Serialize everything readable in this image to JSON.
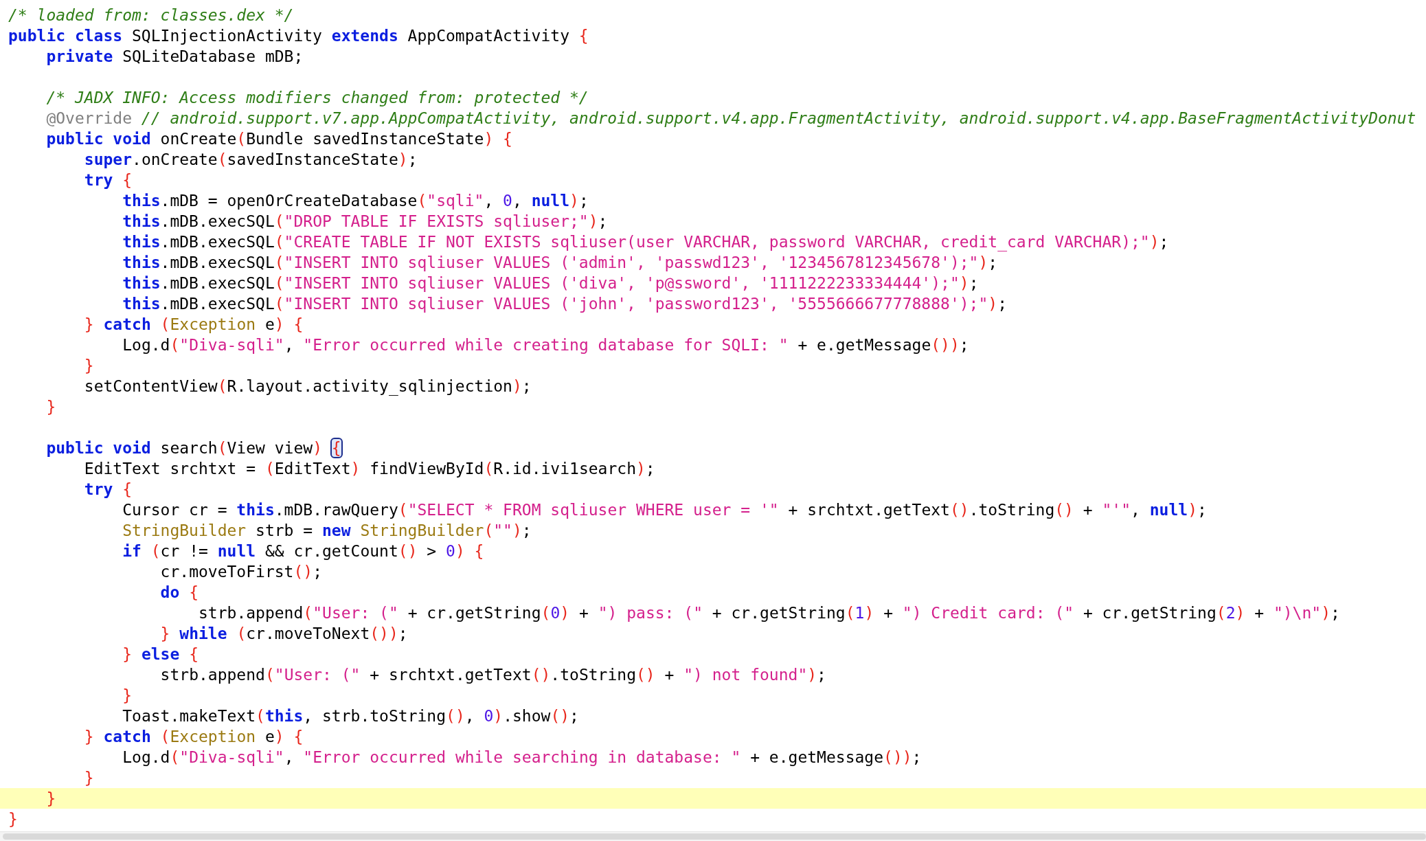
{
  "editor": {
    "lines": [
      {
        "kind": "code",
        "current": false,
        "tokens": [
          {
            "kind": "comment",
            "text": "/* loaded from: classes.dex */"
          }
        ]
      },
      {
        "kind": "code",
        "current": false,
        "tokens": [
          {
            "kind": "keyword",
            "text": "public class"
          },
          {
            "kind": "plain",
            "text": " SQLInjectionActivity "
          },
          {
            "kind": "keyword",
            "text": "extends"
          },
          {
            "kind": "plain",
            "text": " AppCompatActivity "
          },
          {
            "kind": "bracket",
            "text": "{"
          }
        ],
        "children": [
          {
            "kind": "code",
            "current": false,
            "tokens": [
              {
                "kind": "keyword",
                "text": "private"
              },
              {
                "kind": "plain",
                "text": " SQLiteDatabase mDB;"
              }
            ]
          },
          {
            "kind": "blank"
          },
          {
            "kind": "code",
            "current": false,
            "tokens": [
              {
                "kind": "comment",
                "text": "/* JADX INFO: Access modifiers changed from: protected */"
              }
            ]
          },
          {
            "kind": "code",
            "current": false,
            "tokens": [
              {
                "kind": "annotation",
                "text": "@Override"
              },
              {
                "kind": "comment",
                "text": " // android.support.v7.app.AppCompatActivity, android.support.v4.app.FragmentActivity, android.support.v4.app.BaseFragmentActivityDonut"
              }
            ]
          },
          {
            "kind": "code",
            "current": false,
            "tokens": [
              {
                "kind": "keyword",
                "text": "public void"
              },
              {
                "kind": "plain",
                "text": " onCreate"
              },
              {
                "kind": "bracket",
                "text": "("
              },
              {
                "kind": "plain",
                "text": "Bundle savedInstanceState"
              },
              {
                "kind": "bracket",
                "text": ") {"
              }
            ],
            "children": [
              {
                "kind": "code",
                "current": false,
                "tokens": [
                  {
                    "kind": "keyword",
                    "text": "super"
                  },
                  {
                    "kind": "plain",
                    "text": ".onCreate"
                  },
                  {
                    "kind": "bracket",
                    "text": "("
                  },
                  {
                    "kind": "plain",
                    "text": "savedInstanceState"
                  },
                  {
                    "kind": "bracket",
                    "text": ")"
                  },
                  {
                    "kind": "plain",
                    "text": ";"
                  }
                ]
              },
              {
                "kind": "code",
                "current": false,
                "tokens": [
                  {
                    "kind": "keyword",
                    "text": "try"
                  },
                  {
                    "kind": "bracket",
                    "text": " {"
                  }
                ],
                "children": [
                  {
                    "kind": "code",
                    "current": false,
                    "tokens": [
                      {
                        "kind": "keyword",
                        "text": "this"
                      },
                      {
                        "kind": "plain",
                        "text": ".mDB = openOrCreateDatabase"
                      },
                      {
                        "kind": "bracket",
                        "text": "("
                      },
                      {
                        "kind": "string",
                        "text": "\"sqli\""
                      },
                      {
                        "kind": "plain",
                        "text": ", "
                      },
                      {
                        "kind": "number",
                        "text": "0"
                      },
                      {
                        "kind": "plain",
                        "text": ", "
                      },
                      {
                        "kind": "keyword",
                        "text": "null"
                      },
                      {
                        "kind": "bracket",
                        "text": ")"
                      },
                      {
                        "kind": "plain",
                        "text": ";"
                      }
                    ]
                  },
                  {
                    "kind": "code",
                    "current": false,
                    "tokens": [
                      {
                        "kind": "keyword",
                        "text": "this"
                      },
                      {
                        "kind": "plain",
                        "text": ".mDB.execSQL"
                      },
                      {
                        "kind": "bracket",
                        "text": "("
                      },
                      {
                        "kind": "string",
                        "text": "\"DROP TABLE IF EXISTS sqliuser;\""
                      },
                      {
                        "kind": "bracket",
                        "text": ")"
                      },
                      {
                        "kind": "plain",
                        "text": ";"
                      }
                    ]
                  },
                  {
                    "kind": "code",
                    "current": false,
                    "tokens": [
                      {
                        "kind": "keyword",
                        "text": "this"
                      },
                      {
                        "kind": "plain",
                        "text": ".mDB.execSQL"
                      },
                      {
                        "kind": "bracket",
                        "text": "("
                      },
                      {
                        "kind": "string",
                        "text": "\"CREATE TABLE IF NOT EXISTS sqliuser(user VARCHAR, password VARCHAR, credit_card VARCHAR);\""
                      },
                      {
                        "kind": "bracket",
                        "text": ")"
                      },
                      {
                        "kind": "plain",
                        "text": ";"
                      }
                    ]
                  },
                  {
                    "kind": "code",
                    "current": false,
                    "tokens": [
                      {
                        "kind": "keyword",
                        "text": "this"
                      },
                      {
                        "kind": "plain",
                        "text": ".mDB.execSQL"
                      },
                      {
                        "kind": "bracket",
                        "text": "("
                      },
                      {
                        "kind": "string",
                        "text": "\"INSERT INTO sqliuser VALUES ('admin', 'passwd123', '1234567812345678');\""
                      },
                      {
                        "kind": "bracket",
                        "text": ")"
                      },
                      {
                        "kind": "plain",
                        "text": ";"
                      }
                    ]
                  },
                  {
                    "kind": "code",
                    "current": false,
                    "tokens": [
                      {
                        "kind": "keyword",
                        "text": "this"
                      },
                      {
                        "kind": "plain",
                        "text": ".mDB.execSQL"
                      },
                      {
                        "kind": "bracket",
                        "text": "("
                      },
                      {
                        "kind": "string",
                        "text": "\"INSERT INTO sqliuser VALUES ('diva', 'p@ssword', '1111222233334444');\""
                      },
                      {
                        "kind": "bracket",
                        "text": ")"
                      },
                      {
                        "kind": "plain",
                        "text": ";"
                      }
                    ]
                  },
                  {
                    "kind": "code",
                    "current": false,
                    "tokens": [
                      {
                        "kind": "keyword",
                        "text": "this"
                      },
                      {
                        "kind": "plain",
                        "text": ".mDB.execSQL"
                      },
                      {
                        "kind": "bracket",
                        "text": "("
                      },
                      {
                        "kind": "string",
                        "text": "\"INSERT INTO sqliuser VALUES ('john', 'password123', '5555666677778888');\""
                      },
                      {
                        "kind": "bracket",
                        "text": ")"
                      },
                      {
                        "kind": "plain",
                        "text": ";"
                      }
                    ]
                  }
                ]
              },
              {
                "kind": "code",
                "current": false,
                "tokens": [
                  {
                    "kind": "bracket",
                    "text": "} "
                  },
                  {
                    "kind": "keyword",
                    "text": "catch"
                  },
                  {
                    "kind": "bracket",
                    "text": " ("
                  },
                  {
                    "kind": "type",
                    "text": "Exception"
                  },
                  {
                    "kind": "plain",
                    "text": " e"
                  },
                  {
                    "kind": "bracket",
                    "text": ") {"
                  }
                ],
                "children": [
                  {
                    "kind": "code",
                    "current": false,
                    "tokens": [
                      {
                        "kind": "plain",
                        "text": "Log.d"
                      },
                      {
                        "kind": "bracket",
                        "text": "("
                      },
                      {
                        "kind": "string",
                        "text": "\"Diva-sqli\""
                      },
                      {
                        "kind": "plain",
                        "text": ", "
                      },
                      {
                        "kind": "string",
                        "text": "\"Error occurred while creating database for SQLI: \""
                      },
                      {
                        "kind": "plain",
                        "text": " + e.getMessage"
                      },
                      {
                        "kind": "bracket",
                        "text": "())"
                      },
                      {
                        "kind": "plain",
                        "text": ";"
                      }
                    ]
                  }
                ]
              },
              {
                "kind": "code",
                "current": false,
                "tokens": [
                  {
                    "kind": "bracket",
                    "text": "}"
                  }
                ]
              },
              {
                "kind": "code",
                "current": false,
                "tokens": [
                  {
                    "kind": "plain",
                    "text": "setContentView"
                  },
                  {
                    "kind": "bracket",
                    "text": "("
                  },
                  {
                    "kind": "plain",
                    "text": "R.layout.activity_sqlinjection"
                  },
                  {
                    "kind": "bracket",
                    "text": ")"
                  },
                  {
                    "kind": "plain",
                    "text": ";"
                  }
                ]
              }
            ]
          },
          {
            "kind": "code",
            "current": false,
            "tokens": [
              {
                "kind": "bracket",
                "text": "}"
              }
            ]
          },
          {
            "kind": "blank"
          },
          {
            "kind": "code",
            "current": false,
            "tokens": [
              {
                "kind": "keyword",
                "text": "public void"
              },
              {
                "kind": "plain",
                "text": " search"
              },
              {
                "kind": "bracket",
                "text": "("
              },
              {
                "kind": "plain",
                "text": "View view"
              },
              {
                "kind": "bracket",
                "text": ") "
              },
              {
                "kind": "bracket",
                "text": "{",
                "matched": true
              }
            ],
            "children": [
              {
                "kind": "code",
                "current": false,
                "tokens": [
                  {
                    "kind": "plain",
                    "text": "EditText srchtxt = "
                  },
                  {
                    "kind": "bracket",
                    "text": "("
                  },
                  {
                    "kind": "plain",
                    "text": "EditText"
                  },
                  {
                    "kind": "bracket",
                    "text": ")"
                  },
                  {
                    "kind": "plain",
                    "text": " findViewById"
                  },
                  {
                    "kind": "bracket",
                    "text": "("
                  },
                  {
                    "kind": "plain",
                    "text": "R.id.ivi1search"
                  },
                  {
                    "kind": "bracket",
                    "text": ")"
                  },
                  {
                    "kind": "plain",
                    "text": ";"
                  }
                ]
              },
              {
                "kind": "code",
                "current": false,
                "tokens": [
                  {
                    "kind": "keyword",
                    "text": "try"
                  },
                  {
                    "kind": "bracket",
                    "text": " {"
                  }
                ],
                "children": [
                  {
                    "kind": "code",
                    "current": false,
                    "tokens": [
                      {
                        "kind": "plain",
                        "text": "Cursor cr = "
                      },
                      {
                        "kind": "keyword",
                        "text": "this"
                      },
                      {
                        "kind": "plain",
                        "text": ".mDB.rawQuery"
                      },
                      {
                        "kind": "bracket",
                        "text": "("
                      },
                      {
                        "kind": "string",
                        "text": "\"SELECT * FROM sqliuser WHERE user = '\""
                      },
                      {
                        "kind": "plain",
                        "text": " + srchtxt.getText"
                      },
                      {
                        "kind": "bracket",
                        "text": "()"
                      },
                      {
                        "kind": "plain",
                        "text": ".toString"
                      },
                      {
                        "kind": "bracket",
                        "text": "()"
                      },
                      {
                        "kind": "plain",
                        "text": " + "
                      },
                      {
                        "kind": "string",
                        "text": "\"'\""
                      },
                      {
                        "kind": "plain",
                        "text": ", "
                      },
                      {
                        "kind": "keyword",
                        "text": "null"
                      },
                      {
                        "kind": "bracket",
                        "text": ")"
                      },
                      {
                        "kind": "plain",
                        "text": ";"
                      }
                    ]
                  },
                  {
                    "kind": "code",
                    "current": false,
                    "tokens": [
                      {
                        "kind": "type",
                        "text": "StringBuilder"
                      },
                      {
                        "kind": "plain",
                        "text": " strb = "
                      },
                      {
                        "kind": "keyword",
                        "text": "new"
                      },
                      {
                        "kind": "type",
                        "text": " StringBuilder"
                      },
                      {
                        "kind": "bracket",
                        "text": "("
                      },
                      {
                        "kind": "string",
                        "text": "\"\""
                      },
                      {
                        "kind": "bracket",
                        "text": ")"
                      },
                      {
                        "kind": "plain",
                        "text": ";"
                      }
                    ]
                  },
                  {
                    "kind": "code",
                    "current": false,
                    "tokens": [
                      {
                        "kind": "keyword",
                        "text": "if"
                      },
                      {
                        "kind": "bracket",
                        "text": " ("
                      },
                      {
                        "kind": "plain",
                        "text": "cr != "
                      },
                      {
                        "kind": "keyword",
                        "text": "null"
                      },
                      {
                        "kind": "plain",
                        "text": " && cr.getCount"
                      },
                      {
                        "kind": "bracket",
                        "text": "()"
                      },
                      {
                        "kind": "plain",
                        "text": " > "
                      },
                      {
                        "kind": "number",
                        "text": "0"
                      },
                      {
                        "kind": "bracket",
                        "text": ") {"
                      }
                    ],
                    "children": [
                      {
                        "kind": "code",
                        "current": false,
                        "tokens": [
                          {
                            "kind": "plain",
                            "text": "cr.moveToFirst"
                          },
                          {
                            "kind": "bracket",
                            "text": "()"
                          },
                          {
                            "kind": "plain",
                            "text": ";"
                          }
                        ]
                      },
                      {
                        "kind": "code",
                        "current": false,
                        "tokens": [
                          {
                            "kind": "keyword",
                            "text": "do"
                          },
                          {
                            "kind": "bracket",
                            "text": " {"
                          }
                        ],
                        "children": [
                          {
                            "kind": "code",
                            "current": false,
                            "tokens": [
                              {
                                "kind": "plain",
                                "text": "strb.append"
                              },
                              {
                                "kind": "bracket",
                                "text": "("
                              },
                              {
                                "kind": "string",
                                "text": "\"User: (\""
                              },
                              {
                                "kind": "plain",
                                "text": " + cr.getString"
                              },
                              {
                                "kind": "bracket",
                                "text": "("
                              },
                              {
                                "kind": "number",
                                "text": "0"
                              },
                              {
                                "kind": "bracket",
                                "text": ")"
                              },
                              {
                                "kind": "plain",
                                "text": " + "
                              },
                              {
                                "kind": "string",
                                "text": "\") pass: (\""
                              },
                              {
                                "kind": "plain",
                                "text": " + cr.getString"
                              },
                              {
                                "kind": "bracket",
                                "text": "("
                              },
                              {
                                "kind": "number",
                                "text": "1"
                              },
                              {
                                "kind": "bracket",
                                "text": ")"
                              },
                              {
                                "kind": "plain",
                                "text": " + "
                              },
                              {
                                "kind": "string",
                                "text": "\") Credit card: (\""
                              },
                              {
                                "kind": "plain",
                                "text": " + cr.getString"
                              },
                              {
                                "kind": "bracket",
                                "text": "("
                              },
                              {
                                "kind": "number",
                                "text": "2"
                              },
                              {
                                "kind": "bracket",
                                "text": ")"
                              },
                              {
                                "kind": "plain",
                                "text": " + "
                              },
                              {
                                "kind": "string",
                                "text": "\")\\n\""
                              },
                              {
                                "kind": "bracket",
                                "text": ")"
                              },
                              {
                                "kind": "plain",
                                "text": ";"
                              }
                            ]
                          }
                        ]
                      },
                      {
                        "kind": "code",
                        "current": false,
                        "tokens": [
                          {
                            "kind": "bracket",
                            "text": "} "
                          },
                          {
                            "kind": "keyword",
                            "text": "while"
                          },
                          {
                            "kind": "bracket",
                            "text": " ("
                          },
                          {
                            "kind": "plain",
                            "text": "cr.moveToNext"
                          },
                          {
                            "kind": "bracket",
                            "text": "())"
                          },
                          {
                            "kind": "plain",
                            "text": ";"
                          }
                        ]
                      }
                    ]
                  },
                  {
                    "kind": "code",
                    "current": false,
                    "tokens": [
                      {
                        "kind": "bracket",
                        "text": "} "
                      },
                      {
                        "kind": "keyword",
                        "text": "else"
                      },
                      {
                        "kind": "bracket",
                        "text": " {"
                      }
                    ],
                    "children": [
                      {
                        "kind": "code",
                        "current": false,
                        "tokens": [
                          {
                            "kind": "plain",
                            "text": "strb.append"
                          },
                          {
                            "kind": "bracket",
                            "text": "("
                          },
                          {
                            "kind": "string",
                            "text": "\"User: (\""
                          },
                          {
                            "kind": "plain",
                            "text": " + srchtxt.getText"
                          },
                          {
                            "kind": "bracket",
                            "text": "()"
                          },
                          {
                            "kind": "plain",
                            "text": ".toString"
                          },
                          {
                            "kind": "bracket",
                            "text": "()"
                          },
                          {
                            "kind": "plain",
                            "text": " + "
                          },
                          {
                            "kind": "string",
                            "text": "\") not found\""
                          },
                          {
                            "kind": "bracket",
                            "text": ")"
                          },
                          {
                            "kind": "plain",
                            "text": ";"
                          }
                        ]
                      }
                    ]
                  },
                  {
                    "kind": "code",
                    "current": false,
                    "tokens": [
                      {
                        "kind": "bracket",
                        "text": "}"
                      }
                    ]
                  },
                  {
                    "kind": "code",
                    "current": false,
                    "tokens": [
                      {
                        "kind": "plain",
                        "text": "Toast.makeText"
                      },
                      {
                        "kind": "bracket",
                        "text": "("
                      },
                      {
                        "kind": "keyword",
                        "text": "this"
                      },
                      {
                        "kind": "plain",
                        "text": ", strb.toString"
                      },
                      {
                        "kind": "bracket",
                        "text": "()"
                      },
                      {
                        "kind": "plain",
                        "text": ", "
                      },
                      {
                        "kind": "number",
                        "text": "0"
                      },
                      {
                        "kind": "bracket",
                        "text": ")"
                      },
                      {
                        "kind": "plain",
                        "text": ".show"
                      },
                      {
                        "kind": "bracket",
                        "text": "()"
                      },
                      {
                        "kind": "plain",
                        "text": ";"
                      }
                    ]
                  }
                ]
              },
              {
                "kind": "code",
                "current": false,
                "tokens": [
                  {
                    "kind": "bracket",
                    "text": "} "
                  },
                  {
                    "kind": "keyword",
                    "text": "catch"
                  },
                  {
                    "kind": "bracket",
                    "text": " ("
                  },
                  {
                    "kind": "type",
                    "text": "Exception"
                  },
                  {
                    "kind": "plain",
                    "text": " e"
                  },
                  {
                    "kind": "bracket",
                    "text": ") {"
                  }
                ],
                "children": [
                  {
                    "kind": "code",
                    "current": false,
                    "tokens": [
                      {
                        "kind": "plain",
                        "text": "Log.d"
                      },
                      {
                        "kind": "bracket",
                        "text": "("
                      },
                      {
                        "kind": "string",
                        "text": "\"Diva-sqli\""
                      },
                      {
                        "kind": "plain",
                        "text": ", "
                      },
                      {
                        "kind": "string",
                        "text": "\"Error occurred while searching in database: \""
                      },
                      {
                        "kind": "plain",
                        "text": " + e.getMessage"
                      },
                      {
                        "kind": "bracket",
                        "text": "())"
                      },
                      {
                        "kind": "plain",
                        "text": ";"
                      }
                    ]
                  }
                ]
              },
              {
                "kind": "code",
                "current": false,
                "tokens": [
                  {
                    "kind": "bracket",
                    "text": "}"
                  }
                ]
              }
            ]
          },
          {
            "kind": "code",
            "current": true,
            "tokens": [
              {
                "kind": "bracket",
                "text": "}"
              }
            ]
          }
        ]
      },
      {
        "kind": "code",
        "current": false,
        "tokens": [
          {
            "kind": "bracket",
            "text": "}"
          }
        ]
      }
    ]
  }
}
